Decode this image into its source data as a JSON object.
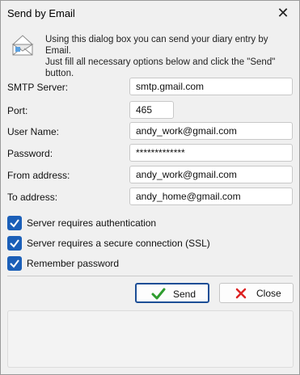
{
  "window": {
    "title": "Send by Email"
  },
  "info": {
    "line1": "Using this dialog box  you can send your diary entry by Email.",
    "line2": "Just fill all necessary options below and click the \"Send\" button."
  },
  "fields": {
    "smtp_server": {
      "label": "SMTP Server:",
      "value": "smtp.gmail.com"
    },
    "port": {
      "label": "Port:",
      "value": "465"
    },
    "user_name": {
      "label": "User Name:",
      "value": "andy_work@gmail.com"
    },
    "password": {
      "label": "Password:",
      "value": "*************"
    },
    "from_address": {
      "label": "From address:",
      "value": "andy_work@gmail.com"
    },
    "to_address": {
      "label": "To address:",
      "value": "andy_home@gmail.com"
    }
  },
  "options": {
    "auth": {
      "label": "Server requires authentication",
      "checked": true
    },
    "ssl": {
      "label": "Server requires a secure connection (SSL)",
      "checked": true
    },
    "remember": {
      "label": "Remember password",
      "checked": true
    }
  },
  "buttons": {
    "send": {
      "label": "Send",
      "icon": "checkmark-icon",
      "color": "#2e9c2e"
    },
    "close": {
      "label": "Close",
      "icon": "close-icon",
      "color": "#d22"
    }
  },
  "colors": {
    "checkbox": "#1b5fb8",
    "primary_border": "#1c4e96"
  }
}
